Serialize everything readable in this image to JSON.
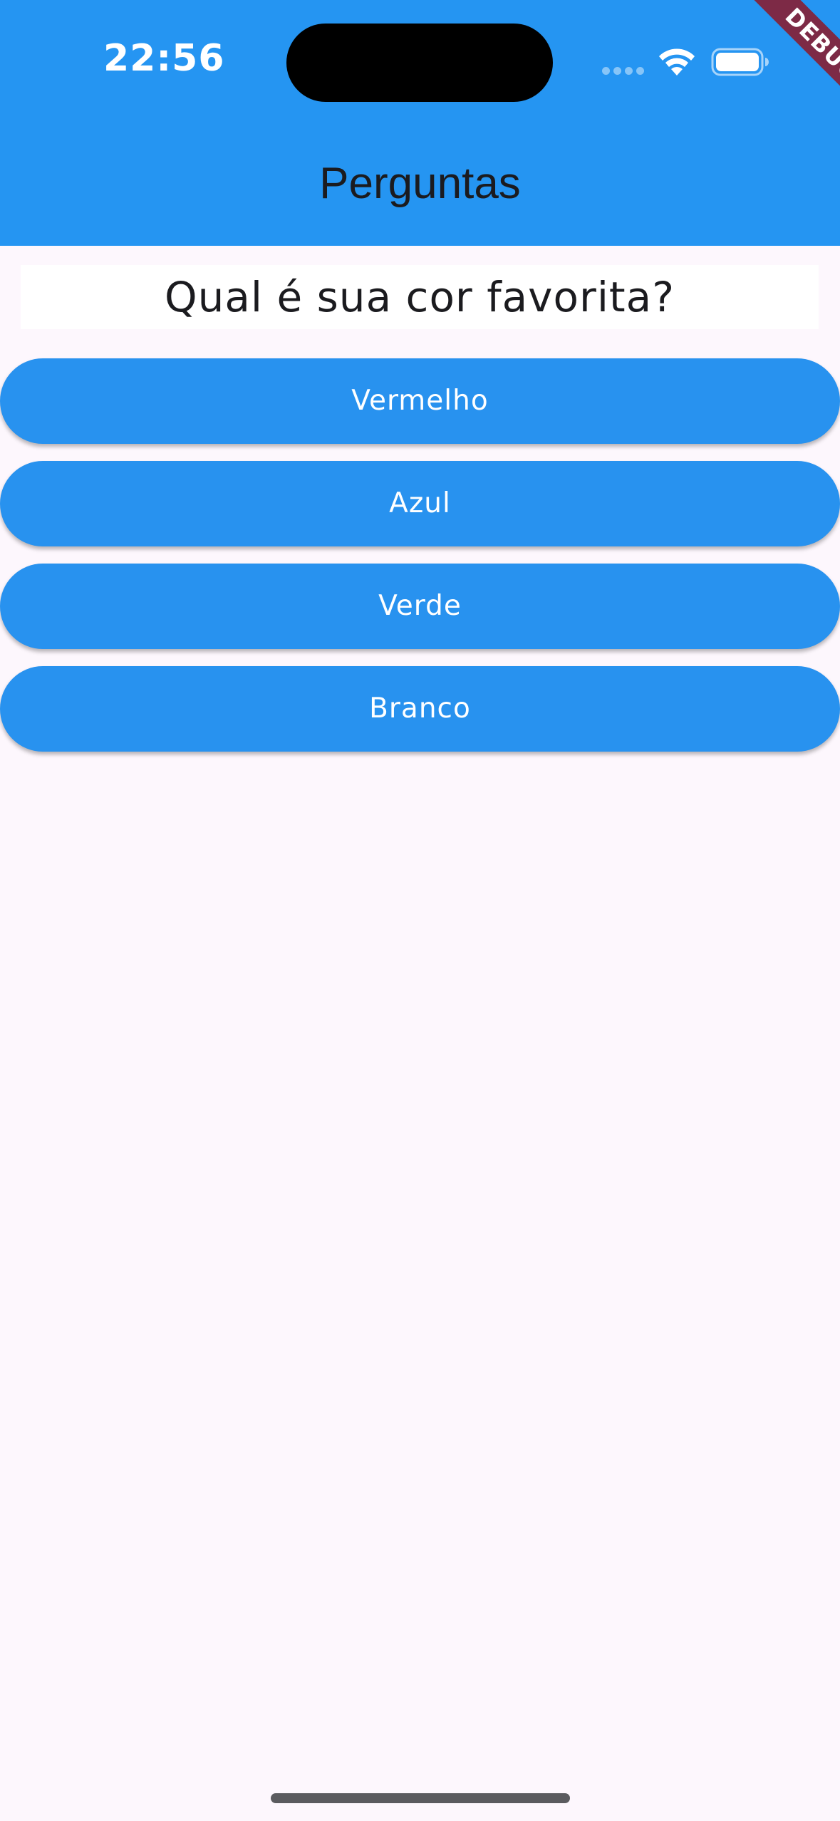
{
  "status_bar": {
    "time": "22:56",
    "icons": [
      "signal-dots-icon",
      "wifi-icon",
      "battery-icon"
    ]
  },
  "debug_banner": {
    "label": "DEBUG",
    "color": "#7d2a46"
  },
  "app_bar": {
    "title": "Perguntas",
    "color": "#2595f2"
  },
  "question": {
    "text": "Qual é sua cor favorita?"
  },
  "answers": [
    {
      "label": "Vermelho"
    },
    {
      "label": "Azul"
    },
    {
      "label": "Verde"
    },
    {
      "label": "Branco"
    }
  ],
  "colors": {
    "accent": "#2892ef",
    "background": "#fdf7fd",
    "text": "#1b1b1f"
  }
}
